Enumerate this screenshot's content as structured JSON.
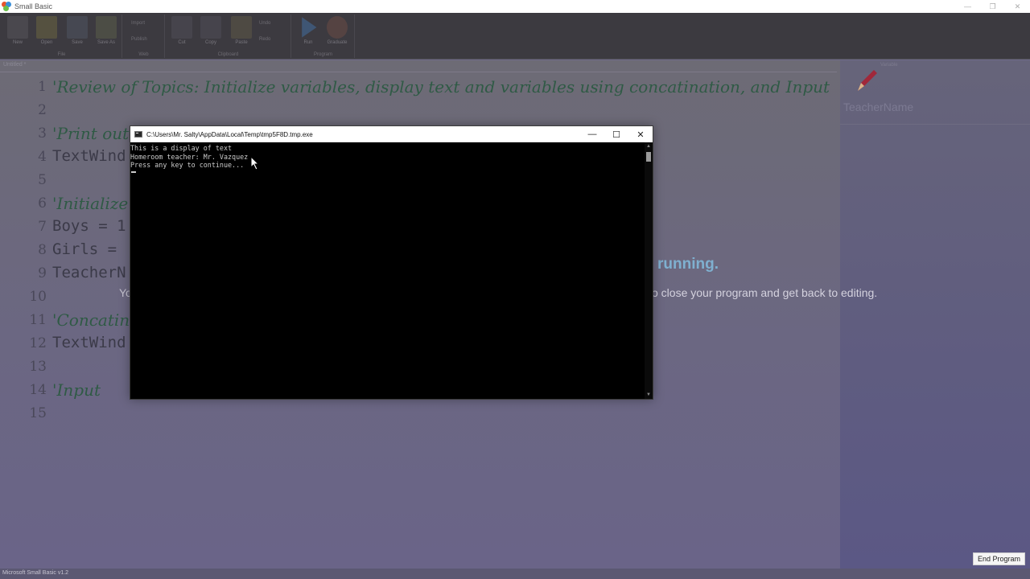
{
  "window": {
    "title": "Small Basic",
    "controls": [
      "minimize",
      "restore",
      "close"
    ]
  },
  "ribbon": {
    "groups": [
      {
        "label": "File",
        "buttons": [
          "New",
          "Open",
          "Save",
          "Save As"
        ]
      },
      {
        "label": "Web",
        "small_buttons": [
          "Import",
          "Publish"
        ]
      },
      {
        "label": "Clipboard",
        "buttons": [
          "Cut",
          "Copy",
          "Paste"
        ],
        "small_buttons": [
          "Undo",
          "Redo"
        ]
      },
      {
        "label": "Program",
        "buttons": [
          "Run",
          "Graduate"
        ]
      }
    ]
  },
  "editor": {
    "doc_tab": "Untitled *",
    "lines": [
      {
        "num": "1",
        "text": "'Review of Topics: Initialize variables, display text and variables using concatination, and Input",
        "type": "comment"
      },
      {
        "num": "2",
        "text": "",
        "type": "blank"
      },
      {
        "num": "3",
        "text": "'Print out",
        "type": "comment"
      },
      {
        "num": "4",
        "text": "TextWind",
        "type": "code"
      },
      {
        "num": "5",
        "text": "",
        "type": "blank"
      },
      {
        "num": "6",
        "text": "'Initialize",
        "type": "comment"
      },
      {
        "num": "7",
        "text": "Boys = 1",
        "type": "code"
      },
      {
        "num": "8",
        "text": "Girls =",
        "type": "code"
      },
      {
        "num": "9",
        "text": "TeacherN",
        "type": "code"
      },
      {
        "num": "10",
        "text": "",
        "type": "blank"
      },
      {
        "num": "11",
        "text": "'Concatin",
        "type": "comment"
      },
      {
        "num": "12",
        "text": "TextWind",
        "type": "code"
      },
      {
        "num": "13",
        "text": "",
        "type": "blank"
      },
      {
        "num": "14",
        "text": "'Input",
        "type": "comment"
      },
      {
        "num": "15",
        "text": "",
        "type": "blank"
      }
    ]
  },
  "right_panel": {
    "label": "Variable",
    "name": "TeacherName"
  },
  "overlay": {
    "running_text": "running.",
    "message_left": "Yo",
    "message_right": "o close your program and get back to editing."
  },
  "console": {
    "title": "C:\\Users\\Mr. Salty\\AppData\\Local\\Temp\\tmp5F8D.tmp.exe",
    "lines": [
      "This is a display of text",
      "Homeroom teacher: Mr. Vazquez",
      "Press any key to continue..."
    ]
  },
  "end_button": "End Program",
  "status_bar": "Microsoft Small Basic v1.2",
  "colors": {
    "console_bg": "#000000",
    "console_text": "#cccccc",
    "running_accent": "#7fb0d0"
  }
}
